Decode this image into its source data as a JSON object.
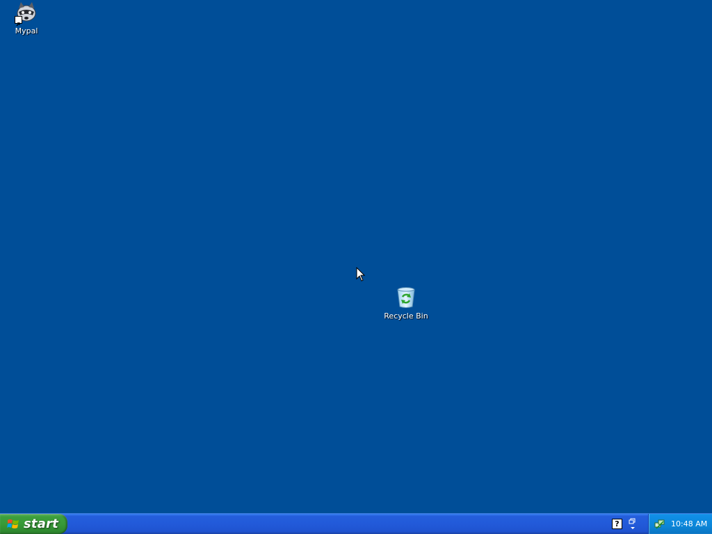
{
  "desktop": {
    "background_color": "#004e98",
    "icons": [
      {
        "label": "Mypal",
        "icon": "mypal-raccoon-icon",
        "shortcut": true
      },
      {
        "label": "Recycle Bin",
        "icon": "recycle-bin-icon",
        "shortcut": false
      }
    ]
  },
  "taskbar": {
    "start_label": "start",
    "quick_tray": {
      "help_glyph": "?"
    },
    "system_tray": {
      "clock": "10:48 AM",
      "icons": [
        "network-icon"
      ]
    },
    "colors": {
      "taskbar": "#245edc",
      "start_button": "#3c9f3c",
      "tray": "#0f8ee6"
    }
  }
}
